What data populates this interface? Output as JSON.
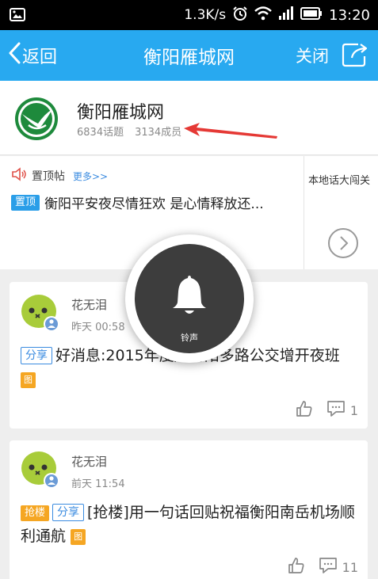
{
  "status_bar": {
    "speed": "1.3K/s",
    "time": "13:20"
  },
  "title_bar": {
    "back_label": "返回",
    "title": "衡阳雁城网",
    "close_label": "关闭"
  },
  "group": {
    "name": "衡阳雁城网",
    "topics": "6834话题",
    "members": "3134成员"
  },
  "pinned": {
    "label": "置顶帖",
    "more": "更多>>",
    "tag": "置顶",
    "title": "衡阳平安夜尽情狂欢 是心情释放还...",
    "side_title": "本地话大闯关"
  },
  "overlay": {
    "label": "铃声"
  },
  "posts": [
    {
      "user": "花无泪",
      "time": "昨天 00:58",
      "tags": [
        "分享"
      ],
      "title": "好消息:2015年度起衡阳多路公交增开夜班",
      "image_tag": "图",
      "likes": "",
      "comments": "1"
    },
    {
      "user": "花无泪",
      "time": "前天 11:54",
      "tags": [
        "抢楼",
        "分享"
      ],
      "title": "[抢楼]用一句话回贴祝福衡阳南岳机场顺利通航",
      "image_tag": "图",
      "likes": "",
      "comments": "11"
    }
  ],
  "colors": {
    "title_bar": "#28a9f0",
    "tag_top": "#2a9ee8",
    "tag_hot": "#f5a623",
    "tag_share": "#3a8be0",
    "annotation_arrow": "#e53935"
  },
  "icons": [
    "image-icon",
    "alarm-icon",
    "wifi-icon",
    "signal-icon",
    "battery-icon",
    "back-chevron-icon",
    "share-icon",
    "speaker-icon",
    "chevron-right-icon",
    "bell-icon",
    "thumbs-up-icon",
    "comment-icon"
  ]
}
